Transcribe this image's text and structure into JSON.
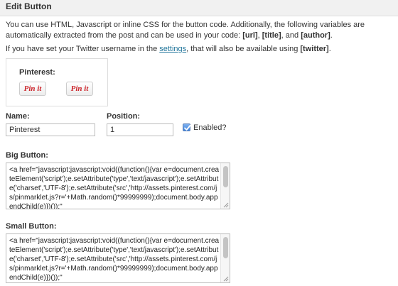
{
  "section": {
    "title": "Edit Button"
  },
  "intro": {
    "line1_pre": "You can use HTML, Javascript or inline CSS for the button code. Additionally, the following variables are automatically extracted from the post and can be used in your code: ",
    "var_url": "[url]",
    "sep1": ", ",
    "var_title": "[title]",
    "sep2": ", and ",
    "var_author": "[author]",
    "end": ".",
    "line2_pre": "If you have set your Twitter username in the ",
    "settings_link": "settings",
    "line2_post": ", that will also be available using ",
    "var_twitter": "[twitter]",
    "line2_end": "."
  },
  "preview": {
    "label": "Pinterest:",
    "buttons": [
      "Pin it",
      "Pin it"
    ]
  },
  "form": {
    "name_label": "Name:",
    "name_value": "Pinterest",
    "position_label": "Position:",
    "position_value": "1",
    "enabled_label": "Enabled?",
    "enabled_checked": true
  },
  "big_button": {
    "label": "Big Button:",
    "code": "<a href=\"javascript:javascript:void((function(){var e=document.createElement('script');e.setAttribute('type','text/javascript');e.setAttribute('charset','UTF-8');e.setAttribute('src','http://assets.pinterest.com/js/pinmarklet.js?r='+Math.random()*99999999);document.body.appendChild(e)})());\""
  },
  "small_button": {
    "label": "Small Button:",
    "code": "<a href=\"javascript:javascript:void((function(){var e=document.createElement('script');e.setAttribute('type','text/javascript');e.setAttribute('charset','UTF-8');e.setAttribute('src','http://assets.pinterest.com/js/pinmarklet.js?r='+Math.random()*99999999);document.body.appendChild(e)})());\""
  },
  "colors": {
    "link": "#21759b",
    "pin_red": "#cb2027",
    "checkbox_blue": "#3d82de"
  }
}
